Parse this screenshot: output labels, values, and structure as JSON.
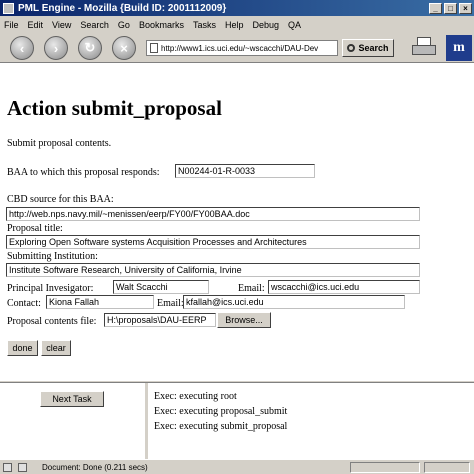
{
  "window": {
    "title": "PML Engine - Mozilla {Build ID: 2001112009}"
  },
  "menu": [
    "File",
    "Edit",
    "View",
    "Search",
    "Go",
    "Bookmarks",
    "Tasks",
    "Help",
    "Debug",
    "QA"
  ],
  "nav": {
    "url": "http://www1.ics.uci.edu/~wscacchi/DAU-Dev",
    "search_label": "Search",
    "logo_glyph": "m"
  },
  "form": {
    "heading": "Action submit_proposal",
    "intro": "Submit proposal contents.",
    "baa_label": "BAA to which this proposal responds:",
    "baa_value": "N00244-01-R-0033",
    "cbd_label": "CBD source for this BAA:",
    "cbd_value": "http://web.nps.navy.mil/~menissen/eerp/FY00/FY00BAA.doc",
    "title_label": "Proposal title:",
    "title_value": "Exploring Open Software systems Acquisition Processes and Architectures",
    "institution_label": "Submitting Institution:",
    "institution_value": "Institute Software Research, University of California, Irvine",
    "pi_label": "Principal Invesigator:",
    "pi_value": "Walt Scacchi",
    "pi_email_label": "Email:",
    "pi_email_value": "wscacchi@ics.uci.edu",
    "contact_label": "Contact:",
    "contact_value": "Kiona Fallah",
    "contact_email_label": "Email:",
    "contact_email_value": "kfallah@ics.uci.edu",
    "file_label": "Proposal contents file:",
    "file_value": "H:\\proposals\\DAU-EERP",
    "browse_label": "Browse...",
    "done_label": "done",
    "clear_label": "clear"
  },
  "bottom": {
    "next_task_label": "Next Task",
    "log": [
      "Exec: executing root",
      "Exec: executing proposal_submit",
      "Exec: executing submit_proposal"
    ]
  },
  "status": {
    "text": "Document: Done (0.211 secs)"
  }
}
